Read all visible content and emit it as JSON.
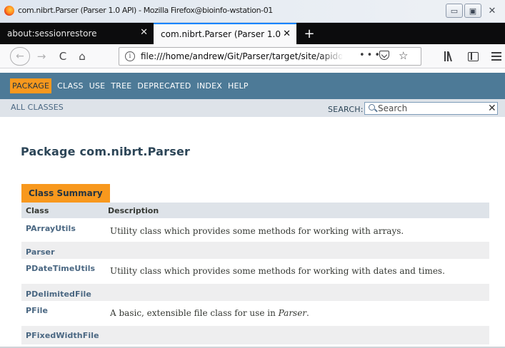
{
  "window": {
    "title": "com.nibrt.Parser (Parser 1.0 API) - Mozilla Firefox@bioinfo-wstation-01",
    "minimize": "▭",
    "maximize": "▣",
    "close": "✕"
  },
  "tabs": [
    {
      "label": "about:sessionrestore",
      "close": "✕"
    },
    {
      "label": "com.nibrt.Parser (Parser 1.0",
      "close": "✕"
    }
  ],
  "new_tab": "+",
  "toolbar": {
    "back": "←",
    "forward": "→",
    "reload": "C",
    "home": "⌂",
    "url": "file:///home/andrew/Git/Parser/target/site/apido",
    "page_actions": "•••",
    "bookmark": "☆"
  },
  "javadoc": {
    "nav": [
      "PACKAGE",
      "CLASS",
      "USE",
      "TREE",
      "DEPRECATED",
      "INDEX",
      "HELP"
    ],
    "all_classes": "ALL CLASSES",
    "search_label": "SEARCH:",
    "search_placeholder": "Search",
    "search_reset": "✕",
    "title": "Package com.nibrt.Parser",
    "summary_caption": "Class Summary",
    "col_headers": {
      "class": "Class",
      "description": "Description"
    },
    "rows": [
      {
        "cls": "PArrayUtils",
        "desc_pre": "Utility class which provides some methods for working with arrays.",
        "desc_em": "",
        "desc_post": ""
      },
      {
        "cls": "Parser",
        "desc_pre": "",
        "desc_em": "",
        "desc_post": ""
      },
      {
        "cls": "PDateTimeUtils",
        "desc_pre": "Utility class which provides some methods for working with dates and times.",
        "desc_em": "",
        "desc_post": ""
      },
      {
        "cls": "PDelimitedFile",
        "desc_pre": "",
        "desc_em": "",
        "desc_post": ""
      },
      {
        "cls": "PFile",
        "desc_pre": "A basic, extensible file class for use in ",
        "desc_em": "Parser",
        "desc_post": "."
      },
      {
        "cls": "PFixedWidthFile",
        "desc_pre": "",
        "desc_em": "",
        "desc_post": ""
      }
    ]
  },
  "colors": {
    "nav_bg": "#4d7a97",
    "nav_current": "#f8981d",
    "subnav_bg": "#dee3e9",
    "link": "#4a6782",
    "title": "#2c4557"
  }
}
